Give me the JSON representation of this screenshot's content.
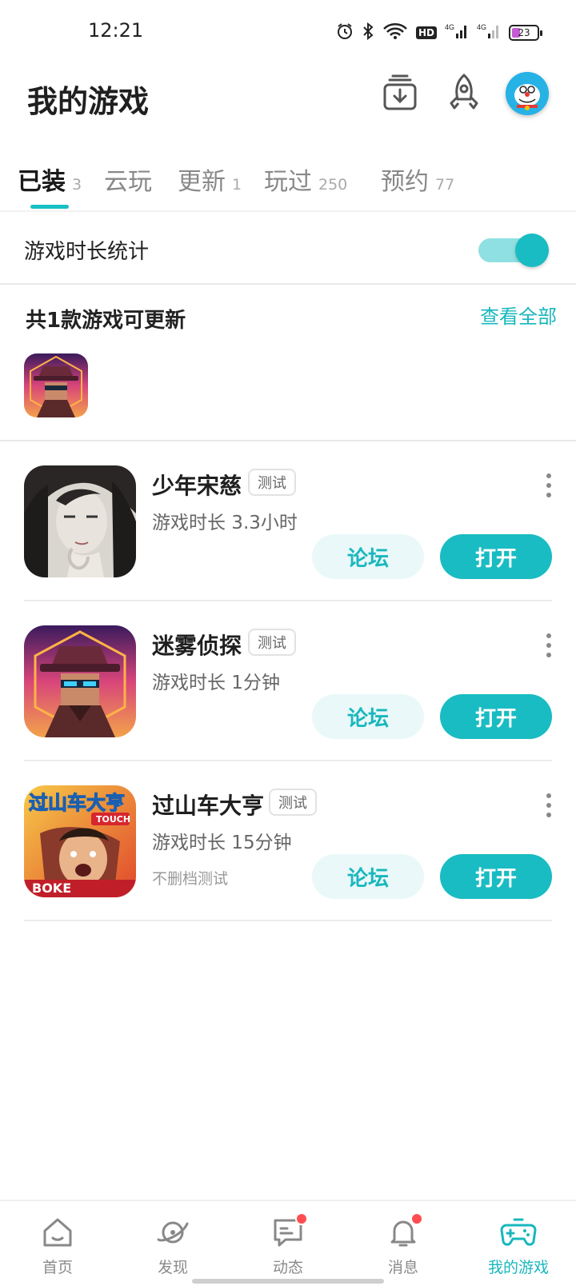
{
  "status_bar": {
    "time": "12:21",
    "battery": "23",
    "hd": "HD"
  },
  "header": {
    "title": "我的游戏"
  },
  "tabs": [
    {
      "label": "已装",
      "count": "3"
    },
    {
      "label": "云玩",
      "count": ""
    },
    {
      "label": "更新",
      "count": "1"
    },
    {
      "label": "玩过",
      "count": "250"
    },
    {
      "label": "预约",
      "count": "77"
    }
  ],
  "stats": {
    "label": "游戏时长统计",
    "toggle_on": true
  },
  "updates": {
    "title": "共1款游戏可更新",
    "view_all": "查看全部"
  },
  "games": [
    {
      "name": "少年宋慈",
      "tag": "测试",
      "play_time": "游戏时长 3.3小时",
      "note": "",
      "forum": "论坛",
      "open": "打开"
    },
    {
      "name": "迷雾侦探",
      "tag": "测试",
      "play_time": "游戏时长 1分钟",
      "note": "",
      "forum": "论坛",
      "open": "打开"
    },
    {
      "name": "过山车大亨",
      "tag": "测试",
      "play_time": "游戏时长 15分钟",
      "note": "不删档测试",
      "forum": "论坛",
      "open": "打开",
      "icon_text": "过山车大亨",
      "icon_sub": "TOUCH",
      "icon_brand": "BOKE"
    }
  ],
  "bottom_nav": [
    {
      "label": "首页",
      "icon": "home-icon"
    },
    {
      "label": "发现",
      "icon": "planet-icon"
    },
    {
      "label": "动态",
      "icon": "chat-icon"
    },
    {
      "label": "消息",
      "icon": "bell-icon"
    },
    {
      "label": "我的游戏",
      "icon": "gamepad-icon"
    }
  ],
  "colors": {
    "accent": "#19bcc2",
    "badge": "#ff4d4f"
  }
}
